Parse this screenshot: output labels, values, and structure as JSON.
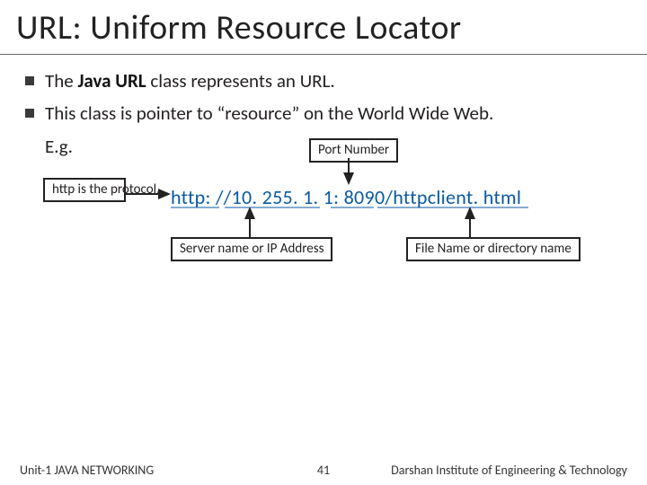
{
  "title": "URL: Uniform Resource Locator",
  "bullets": [
    {
      "pre": "The ",
      "bold": "Java URL",
      "post": " class represents an URL."
    },
    {
      "text": "This class is pointer to  “resource” on the World Wide Web."
    }
  ],
  "eg": "E.g.",
  "url": "http: //10. 255. 1. 1: 8090/httpclient. html",
  "labels": {
    "protocol": "http is the protocol.",
    "port": "Port Number",
    "server": "Server name or IP Address",
    "file": "File Name or directory name"
  },
  "footer": {
    "left": "Unit-1 JAVA NETWORKING",
    "page": "41",
    "right": "Darshan Institute of Engineering & Technology"
  }
}
